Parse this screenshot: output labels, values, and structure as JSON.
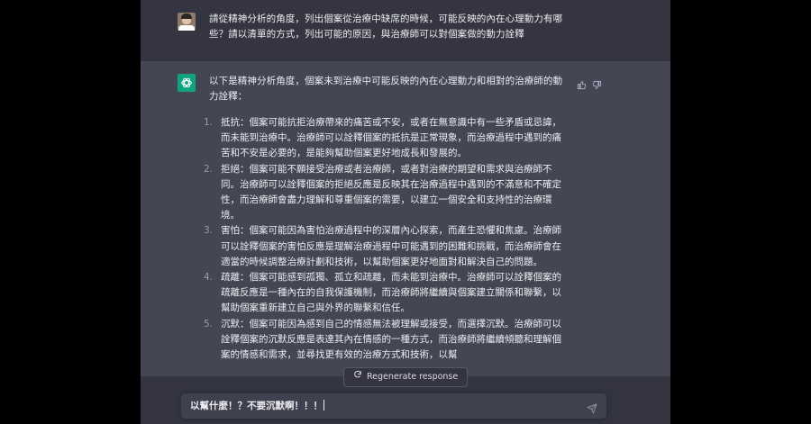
{
  "conversation": {
    "user_prompt": "請從精神分析的角度，列出個案從治療中缺席的時候，可能反映的內在心理動力有哪些？請以清單的方式，列出可能的原因，與治療師可以對個案做的動力詮釋",
    "assistant_intro": "以下是精神分析角度，個案未到治療中可能反映的內在心理動力和相對的治療師的動力詮釋：",
    "items": [
      {
        "number": "1.",
        "text": "抵抗：個案可能抗拒治療帶來的痛苦或不安，或者在無意識中有一些矛盾或忌諱，而未能到治療中。治療師可以詮釋個案的抵抗是正常現象，而治療過程中遇到的痛苦和不安是必要的，是能夠幫助個案更好地成長和發展的。"
      },
      {
        "number": "2.",
        "text": "拒絕：個案可能不願接受治療或者治療師，或者對治療的期望和需求與治療師不同。治療師可以詮釋個案的拒絕反應是反映其在治療過程中遇到的不滿意和不確定性，而治療師會盡力理解和尊重個案的需要，以建立一個安全和支持性的治療環境。"
      },
      {
        "number": "3.",
        "text": "害怕：個案可能因為害怕治療過程中的深層內心探索，而產生恐懼和焦慮。治療師可以詮釋個案的害怕反應是理解治療過程中可能遇到的困難和挑戰，而治療師會在適當的時候調整治療計劃和技術，以幫助個案更好地面對和解決自己的問題。"
      },
      {
        "number": "4.",
        "text": "疏離：個案可能感到孤獨、孤立和疏離，而未能到治療中。治療師可以詮釋個案的疏離反應是一種內在的自我保護機制，而治療師將繼續與個案建立關係和聯繫，以幫助個案重新建立自己與外界的聯繫和信任。"
      },
      {
        "number": "5.",
        "text": "沉默：個案可能因為感到自己的情感無法被理解或接受，而選擇沉默。治療師可以詮釋個案的沉默反應是表達其內在情感的一種方式，而治療師將繼續傾聽和理解個案的情感和需求，並尋找更有效的治療方式和技術，以幫"
      }
    ]
  },
  "controls": {
    "regenerate_label": "Regenerate response",
    "composer_value": "以幫什麼！？不要沉默啊！！！"
  },
  "icons": {
    "assistant_avatar": "openai-logo-icon",
    "thumbs_up": "thumbs-up-icon",
    "thumbs_down": "thumbs-down-icon",
    "regenerate": "refresh-icon",
    "send": "paper-plane-icon"
  },
  "colors": {
    "background_outer": "#000000",
    "user_row": "#343541",
    "assistant_row": "#444654",
    "assistant_avatar": "#10a37f",
    "text": "#ececf1"
  }
}
